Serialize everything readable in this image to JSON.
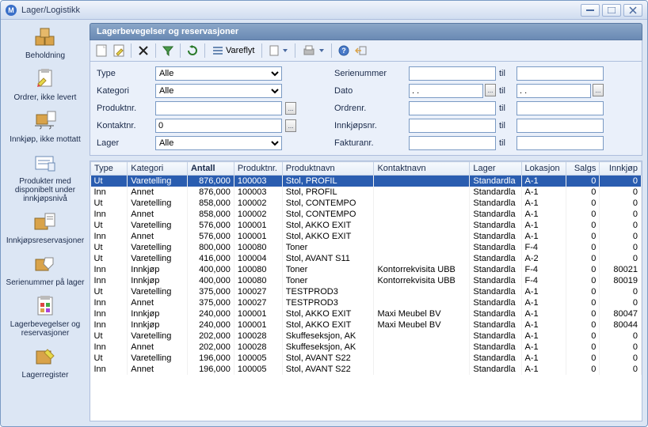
{
  "window": {
    "title": "Lager/Logistikk"
  },
  "sidebar": {
    "items": [
      {
        "label": "Beholdning"
      },
      {
        "label": "Ordrer, ikke levert"
      },
      {
        "label": "Innkjøp, ikke mottatt"
      },
      {
        "label": "Produkter med disponibelt under innkjøpsnivå"
      },
      {
        "label": "Innkjøpsreservasjoner"
      },
      {
        "label": "Serienummer på lager"
      },
      {
        "label": "Lagerbevegelser og reservasjoner"
      },
      {
        "label": "Lagerregister"
      }
    ]
  },
  "panel": {
    "header": "Lagerbevegelser og reservasjoner"
  },
  "toolbar": {
    "vareflyt": "Vareflyt"
  },
  "filters": {
    "type_label": "Type",
    "type_value": "Alle",
    "kategori_label": "Kategori",
    "kategori_value": "Alle",
    "produktnr_label": "Produktnr.",
    "produktnr_value": "",
    "kontaktnr_label": "Kontaktnr.",
    "kontaktnr_value": "0",
    "lager_label": "Lager",
    "lager_value": "Alle",
    "serienummer_label": "Serienummer",
    "serienummer_value": "",
    "serienummer_til": "",
    "dato_label": "Dato",
    "dato_from": ". .",
    "dato_to": ". .",
    "ordrenr_label": "Ordrenr.",
    "ordrenr_from": "",
    "ordrenr_to": "",
    "innkjopsnr_label": "Innkjøpsnr.",
    "innkjopsnr_from": "",
    "innkjopsnr_to": "",
    "fakturanr_label": "Fakturanr.",
    "fakturanr_from": "",
    "fakturanr_to": "",
    "til_label": "til",
    "dots": "..."
  },
  "grid": {
    "headers": [
      "Type",
      "Kategori",
      "Antall",
      "Produktnr.",
      "Produktnavn",
      "Kontaktnavn",
      "Lager",
      "Lokasjon",
      "Salgs",
      "Innkjøp"
    ],
    "sorted_col": 2,
    "rows": [
      {
        "sel": true,
        "type": "Ut",
        "kategori": "Varetelling",
        "antall": "876,000",
        "produktnr": "100003",
        "produktnavn": "Stol, PROFIL",
        "kontakt": "",
        "lager": "Standardla",
        "lok": "A-1",
        "salgs": "0",
        "innk": "0"
      },
      {
        "type": "Inn",
        "kategori": "Annet",
        "antall": "876,000",
        "produktnr": "100003",
        "produktnavn": "Stol, PROFIL",
        "kontakt": "",
        "lager": "Standardla",
        "lok": "A-1",
        "salgs": "0",
        "innk": "0"
      },
      {
        "type": "Ut",
        "kategori": "Varetelling",
        "antall": "858,000",
        "produktnr": "100002",
        "produktnavn": "Stol, CONTEMPO",
        "kontakt": "",
        "lager": "Standardla",
        "lok": "A-1",
        "salgs": "0",
        "innk": "0"
      },
      {
        "type": "Inn",
        "kategori": "Annet",
        "antall": "858,000",
        "produktnr": "100002",
        "produktnavn": "Stol, CONTEMPO",
        "kontakt": "",
        "lager": "Standardla",
        "lok": "A-1",
        "salgs": "0",
        "innk": "0"
      },
      {
        "type": "Ut",
        "kategori": "Varetelling",
        "antall": "576,000",
        "produktnr": "100001",
        "produktnavn": "Stol, AKKO EXIT",
        "kontakt": "",
        "lager": "Standardla",
        "lok": "A-1",
        "salgs": "0",
        "innk": "0"
      },
      {
        "type": "Inn",
        "kategori": "Annet",
        "antall": "576,000",
        "produktnr": "100001",
        "produktnavn": "Stol, AKKO EXIT",
        "kontakt": "",
        "lager": "Standardla",
        "lok": "A-1",
        "salgs": "0",
        "innk": "0"
      },
      {
        "type": "Ut",
        "kategori": "Varetelling",
        "antall": "800,000",
        "produktnr": "100080",
        "produktnavn": "Toner",
        "kontakt": "",
        "lager": "Standardla",
        "lok": "F-4",
        "salgs": "0",
        "innk": "0"
      },
      {
        "type": "Ut",
        "kategori": "Varetelling",
        "antall": "416,000",
        "produktnr": "100004",
        "produktnavn": "Stol, AVANT S11",
        "kontakt": "",
        "lager": "Standardla",
        "lok": "A-2",
        "salgs": "0",
        "innk": "0"
      },
      {
        "type": "Inn",
        "kategori": "Innkjøp",
        "antall": "400,000",
        "produktnr": "100080",
        "produktnavn": "Toner",
        "kontakt": "Kontorrekvisita UBB",
        "lager": "Standardla",
        "lok": "F-4",
        "salgs": "0",
        "innk": "80021"
      },
      {
        "type": "Inn",
        "kategori": "Innkjøp",
        "antall": "400,000",
        "produktnr": "100080",
        "produktnavn": "Toner",
        "kontakt": "Kontorrekvisita UBB",
        "lager": "Standardla",
        "lok": "F-4",
        "salgs": "0",
        "innk": "80019"
      },
      {
        "type": "Ut",
        "kategori": "Varetelling",
        "antall": "375,000",
        "produktnr": "100027",
        "produktnavn": "TESTPROD3",
        "kontakt": "",
        "lager": "Standardla",
        "lok": "A-1",
        "salgs": "0",
        "innk": "0"
      },
      {
        "type": "Inn",
        "kategori": "Annet",
        "antall": "375,000",
        "produktnr": "100027",
        "produktnavn": "TESTPROD3",
        "kontakt": "",
        "lager": "Standardla",
        "lok": "A-1",
        "salgs": "0",
        "innk": "0"
      },
      {
        "type": "Inn",
        "kategori": "Innkjøp",
        "antall": "240,000",
        "produktnr": "100001",
        "produktnavn": "Stol, AKKO EXIT",
        "kontakt": "Maxi Meubel BV",
        "lager": "Standardla",
        "lok": "A-1",
        "salgs": "0",
        "innk": "80047"
      },
      {
        "type": "Inn",
        "kategori": "Innkjøp",
        "antall": "240,000",
        "produktnr": "100001",
        "produktnavn": "Stol, AKKO EXIT",
        "kontakt": "Maxi Meubel BV",
        "lager": "Standardla",
        "lok": "A-1",
        "salgs": "0",
        "innk": "80044"
      },
      {
        "type": "Ut",
        "kategori": "Varetelling",
        "antall": "202,000",
        "produktnr": "100028",
        "produktnavn": "Skuffeseksjon, AK",
        "kontakt": "",
        "lager": "Standardla",
        "lok": "A-1",
        "salgs": "0",
        "innk": "0"
      },
      {
        "type": "Inn",
        "kategori": "Annet",
        "antall": "202,000",
        "produktnr": "100028",
        "produktnavn": "Skuffeseksjon, AK",
        "kontakt": "",
        "lager": "Standardla",
        "lok": "A-1",
        "salgs": "0",
        "innk": "0"
      },
      {
        "type": "Ut",
        "kategori": "Varetelling",
        "antall": "196,000",
        "produktnr": "100005",
        "produktnavn": "Stol, AVANT S22",
        "kontakt": "",
        "lager": "Standardla",
        "lok": "A-1",
        "salgs": "0",
        "innk": "0"
      },
      {
        "type": "Inn",
        "kategori": "Annet",
        "antall": "196,000",
        "produktnr": "100005",
        "produktnavn": "Stol, AVANT S22",
        "kontakt": "",
        "lager": "Standardla",
        "lok": "A-1",
        "salgs": "0",
        "innk": "0"
      }
    ]
  }
}
